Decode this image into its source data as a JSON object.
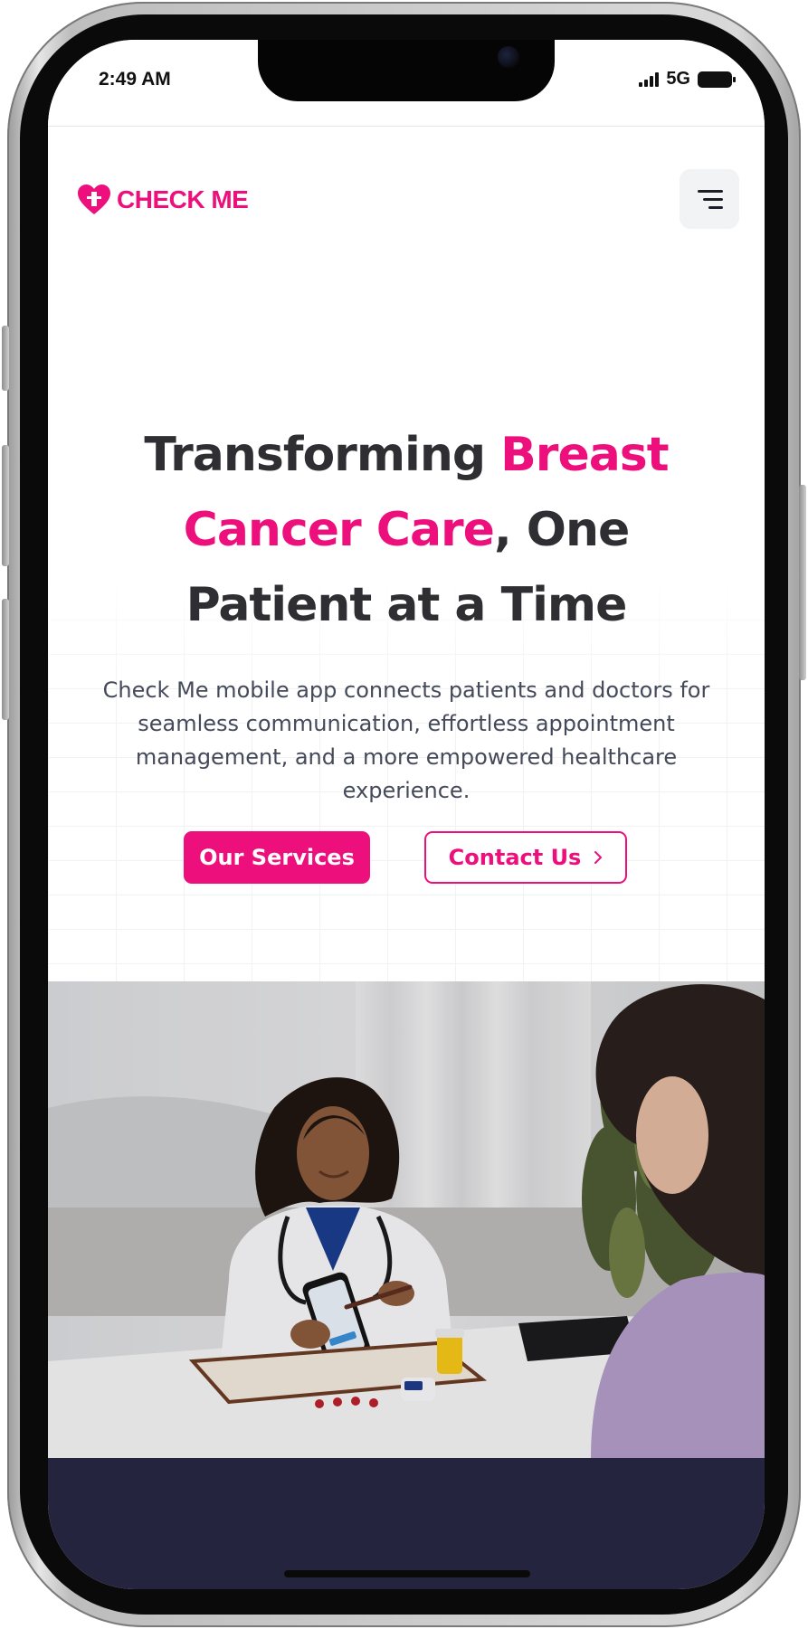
{
  "status_bar": {
    "time": "2:49 AM",
    "network": "5G"
  },
  "brand": {
    "name": "CHECK ME",
    "accent_color": "#ec0f7c",
    "icon": "heart-logo-icon"
  },
  "header": {
    "menu_icon": "hamburger-menu-icon"
  },
  "hero": {
    "headline_part1": "Transforming ",
    "headline_highlight": "Breast Cancer Care",
    "headline_part2": ", One Patient at a Time",
    "description": "Check Me mobile app connects patients and doctors for seamless communication, effortless appointment management, and a more empowered healthcare experience.",
    "primary_button": "Our Services",
    "secondary_button": "Contact Us",
    "secondary_button_icon": "chevron-right-icon"
  },
  "colors": {
    "text_dark": "#2f2f33",
    "footer_band": "#25243f"
  }
}
